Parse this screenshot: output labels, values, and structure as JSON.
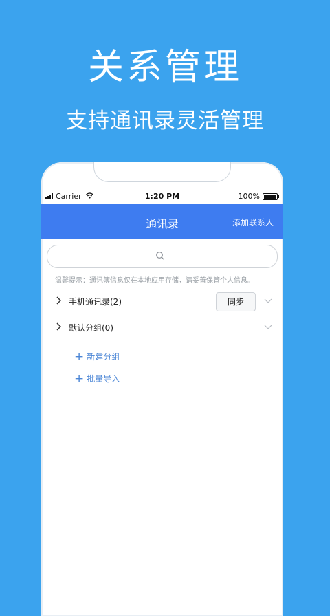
{
  "hero": {
    "title": "关系管理",
    "subtitle": "支持通讯录灵活管理"
  },
  "status_bar": {
    "carrier": "Carrier",
    "time": "1:20 PM",
    "battery": "100%"
  },
  "nav": {
    "title": "通讯录",
    "action": "添加联系人"
  },
  "search": {
    "icon": "search-icon"
  },
  "tip": "温馨提示：通讯簿信息仅在本地应用存储，请妥善保管个人信息。",
  "groups": [
    {
      "label": "手机通讯录(2)",
      "sync_label": "同步"
    },
    {
      "label": "默认分组(0)"
    }
  ],
  "actions": {
    "new_group": "新建分组",
    "batch_import": "批量导入"
  },
  "colors": {
    "background": "#3ba3ee",
    "nav_bar": "#3e7cf0",
    "link": "#4b86d6"
  }
}
